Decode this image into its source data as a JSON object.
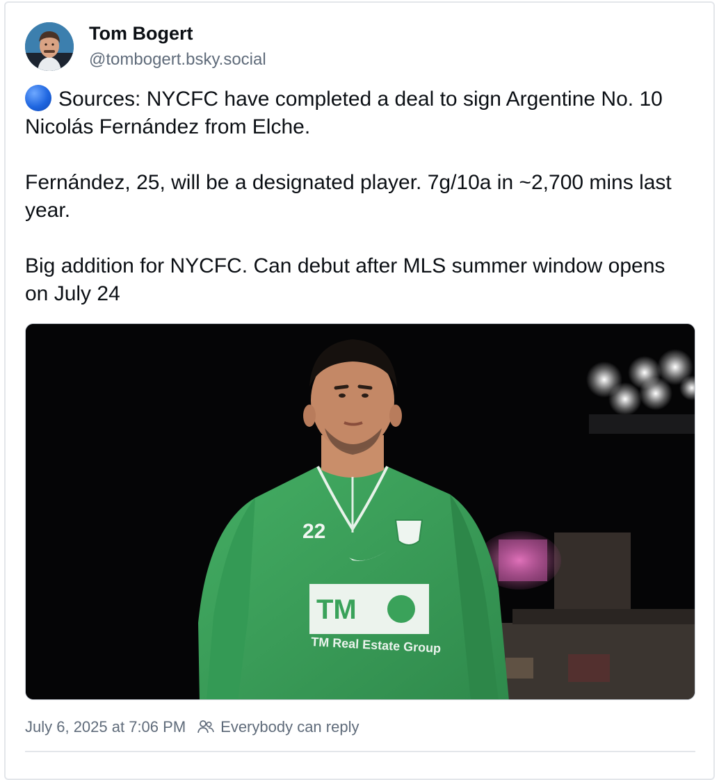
{
  "post": {
    "author": {
      "display_name": "Tom Bogert",
      "handle": "@tombogert.bsky.social",
      "avatar_icon": "avatar-photo"
    },
    "status_icon": "blue-circle-emoji",
    "text": "Sources: NYCFC have completed a deal to sign Argentine No. 10 Nicolás Fernández from Elche.\n\nFernández, 25, will be a designated player. 7g/10a in ~2,700 mins last year.\n\nBig addition for NYCFC. Can debut after MLS summer window opens on July 24",
    "image": {
      "jersey_number": "22",
      "sponsor_logo": "TM",
      "sponsor_name": "TM Real Estate Group"
    },
    "timestamp": "July 6, 2025 at 7:06 PM",
    "reply_setting": "Everybody can reply",
    "reply_icon": "people-icon"
  },
  "colors": {
    "text_primary": "#0b0f14",
    "text_secondary": "#5f6b7a",
    "border": "#e3e6ea",
    "jersey_green": "#3aa25a"
  }
}
